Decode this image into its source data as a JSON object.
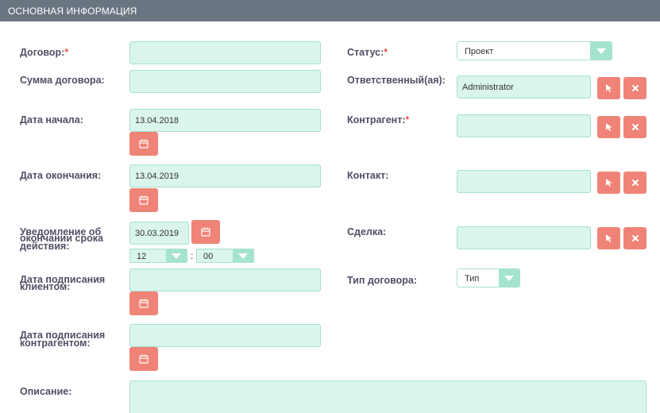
{
  "header": {
    "title": "ОСНОВНАЯ ИНФОРМАЦИЯ"
  },
  "left": {
    "contract_label": "Договор:",
    "required_mark": "*",
    "amount_label": "Сумма договора:",
    "start_date_label": "Дата начала:",
    "start_date_value": "13.04.2018",
    "end_date_label": "Дата окончания:",
    "end_date_value": "13.04.2019",
    "notice_label_1": "Уведомление об",
    "notice_label_2": "окончании срока",
    "notice_label_3": "действия:",
    "notice_date_value": "30.03.2019",
    "notice_hour": "12",
    "time_sep": ":",
    "notice_minute": "00",
    "client_signed_label_1": "Дата подписания",
    "client_signed_label_2": "клиентом:",
    "contractor_signed_label_1": "Дата подписания",
    "contractor_signed_label_2": "контрагентом:",
    "description_label": "Описание:"
  },
  "right": {
    "status_label": "Статус:",
    "status_value": "Проект",
    "responsible_label": "Ответственный(ая):",
    "responsible_value": "Administrator",
    "contractor_label": "Контрагент:",
    "contact_label": "Контакт:",
    "deal_label": "Сделка:",
    "contract_type_label": "Тип договора:",
    "contract_type_value": "Тип"
  },
  "icons": {
    "calendar": "calendar-icon",
    "select": "arrow-select-icon",
    "clear": "clear-x-icon",
    "dropdown": "chevron-down-icon"
  },
  "colors": {
    "header_bg": "#6a7581",
    "input_bg": "#d9f5ec",
    "input_border": "#a7e0cf",
    "button_bg": "#f08377",
    "required": "#ff0000",
    "label": "#534d64"
  }
}
